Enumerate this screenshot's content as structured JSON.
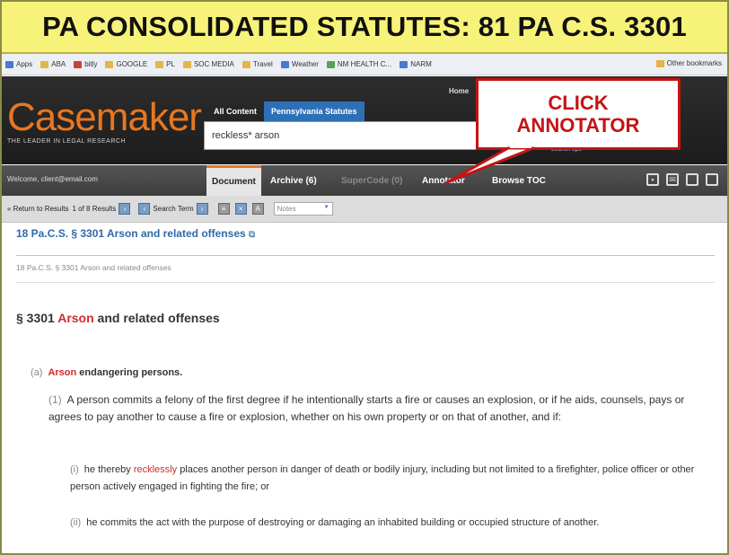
{
  "banner": {
    "title": "PA CONSOLIDATED STATUTES: 81 PA C.S. 3301"
  },
  "bookmarks": {
    "items": [
      "Apps",
      "ABA",
      "bitly",
      "GOOGLE",
      "PL",
      "SOC MEDIA",
      "Travel",
      "Weather",
      "NM HEALTH C...",
      "NARM"
    ],
    "other": "Other bookmarks"
  },
  "header": {
    "logo": "Casemaker",
    "tagline": "THE LEADER IN LEGAL RESEARCH",
    "home_link": "Home",
    "tabs": [
      "All Content",
      "Pennsylvania Statutes"
    ],
    "search_value": "reckless* arson",
    "search_tips": "search tips"
  },
  "callout": {
    "line1": "CLICK",
    "line2": "ANNOTATOR"
  },
  "toolbar": {
    "welcome": "Welcome, client@email.com",
    "tabs": [
      "Document",
      "Archive (6)",
      "SuperCode (0)",
      "Annotator",
      "Browse TOC"
    ]
  },
  "nav": {
    "return": "« Return to Results",
    "results": "1 of 8 Results",
    "search_term": "Search Term",
    "notes": "Notes"
  },
  "doc": {
    "title": "18 Pa.C.S. § 3301 Arson and related offenses",
    "breadcrumb": "18 Pa.C.S. § 3301 Arson and related offenses",
    "heading_prefix": "§ 3301",
    "heading_term": "Arson",
    "heading_rest": "and related offenses",
    "sub_a_marker": "(a)",
    "sub_a_term": "Arson",
    "sub_a_rest": "endangering persons.",
    "p1_marker": "(1)",
    "p1_text": "A person commits a felony of the first degree if he intentionally starts a fire or causes an explosion, or if he aids, counsels, pays or agrees to pay another to cause a fire or explosion, whether on his own property or on that of another, and if:",
    "p2_marker": "(i)",
    "p2_before": "he thereby",
    "p2_term": "recklessly",
    "p2_after": "places another person in danger of death or bodily injury, including but not limited to a firefighter, police officer or other person actively engaged in fighting the fire; or",
    "p3_marker": "(ii)",
    "p3_text": "he commits the act with the purpose of destroying or damaging an inhabited building or occupied structure of another."
  },
  "colors": {
    "brand_orange": "#e77722",
    "callout_red": "#c41414",
    "link_blue": "#2e6aa8",
    "banner_yellow": "#f7f37a"
  }
}
